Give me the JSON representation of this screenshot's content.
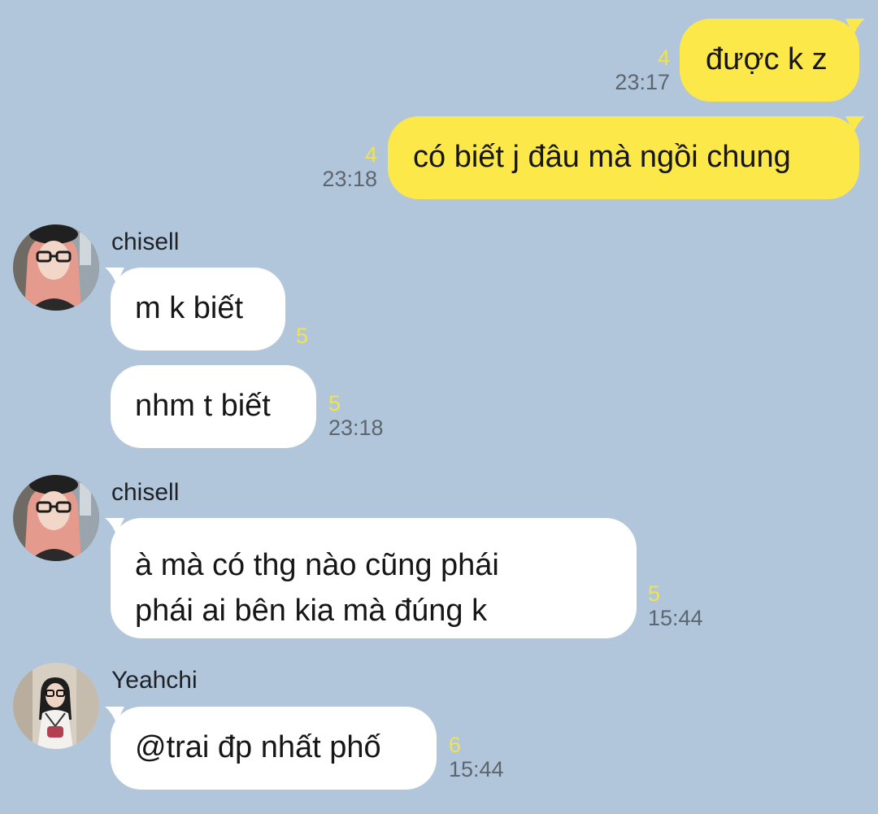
{
  "colors": {
    "background": "#b2c6db",
    "my_bubble": "#fde84a",
    "their_bubble": "#ffffff",
    "unread_count": "#f2e24c",
    "timestamp": "#5d6670"
  },
  "messages": [
    {
      "from": "me",
      "text": "được k z",
      "unread": "4",
      "time": "23:17"
    },
    {
      "from": "me",
      "text": "có biết j đâu mà ngồi chung",
      "unread": "4",
      "time": "23:18"
    },
    {
      "from": "them",
      "sender": "chisell",
      "text": "m k biết",
      "unread": "5",
      "time": ""
    },
    {
      "from": "them",
      "sender": "",
      "text": "nhm t biết",
      "unread": "5",
      "time": "23:18"
    },
    {
      "from": "them",
      "sender": "chisell",
      "text_lines": [
        "à mà có thg nào cũng phái",
        "phái ai bên kia mà đúng k"
      ],
      "unread": "5",
      "time": "15:44"
    },
    {
      "from": "them",
      "sender": "Yeahchi",
      "text": "@trai đp nhất phố",
      "unread": "6",
      "time": "15:44"
    }
  ],
  "avatars": {
    "chisell": "profile-photo",
    "Yeahchi": "profile-photo"
  }
}
